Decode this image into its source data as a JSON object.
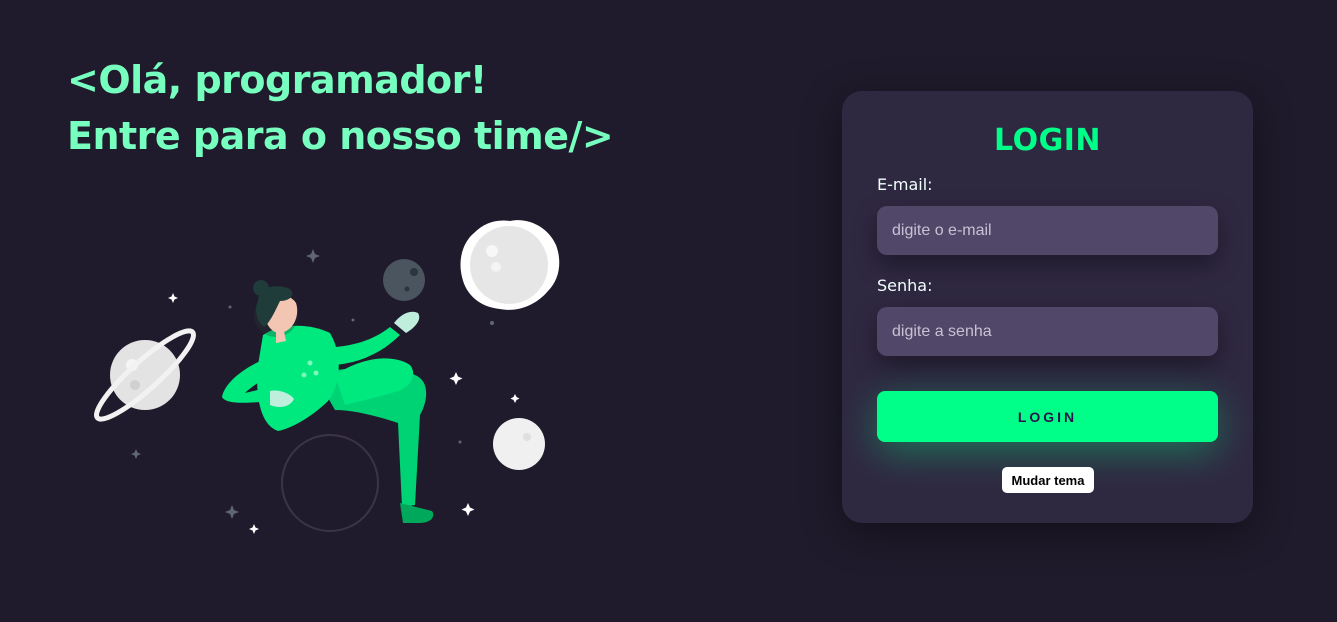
{
  "hero": {
    "line1": "<Olá, programador!",
    "line2": "Entre para o nosso time/>"
  },
  "login": {
    "title": "LOGIN",
    "email": {
      "label": "E-mail:",
      "placeholder": "digite o e-mail",
      "value": ""
    },
    "password": {
      "label": "Senha:",
      "placeholder": "digite a senha",
      "value": ""
    },
    "submit_label": "LOGIN",
    "theme_toggle_label": "Mudar tema"
  },
  "colors": {
    "background": "#201b2c",
    "card": "#2f2841",
    "input": "#514869",
    "accent": "#00ff88",
    "headline": "#77ffc0"
  },
  "icons": [
    "astronaut-illustration",
    "planet-icon",
    "moon-icon",
    "star-icon"
  ]
}
